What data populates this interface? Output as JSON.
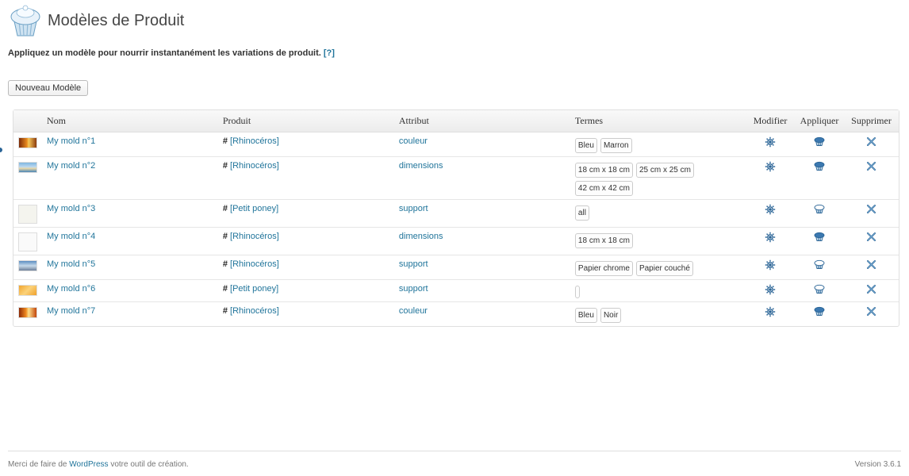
{
  "header": {
    "title": "Modèles de Produit",
    "logo_icon": "cupcake-icon"
  },
  "subtitle": {
    "text": "Appliquez un modèle pour nourrir instantanément les variations de produit.",
    "help_link": "[?]"
  },
  "toolbar": {
    "new_button": "Nouveau Modèle"
  },
  "table": {
    "columns": {
      "name": "Nom",
      "product": "Produit",
      "attribute": "Attribut",
      "terms": "Termes",
      "edit": "Modifier",
      "apply": "Appliquer",
      "delete": "Supprimer"
    },
    "product_prefix": "#",
    "rows": [
      {
        "name": "My mold n°1",
        "product": "[Rhinocéros]",
        "attribute": "couleur",
        "terms": [
          "Bleu",
          "Marron"
        ]
      },
      {
        "name": "My mold n°2",
        "product": "[Rhinocéros]",
        "attribute": "dimensions",
        "terms": [
          "18 cm x 18 cm",
          "25 cm x 25 cm",
          "42 cm x 42 cm"
        ]
      },
      {
        "name": "My mold n°3",
        "product": "[Petit poney]",
        "attribute": "support",
        "terms": [
          "all"
        ]
      },
      {
        "name": "My mold n°4",
        "product": "[Rhinocéros]",
        "attribute": "dimensions",
        "terms": [
          "18 cm x 18 cm"
        ]
      },
      {
        "name": "My mold n°5",
        "product": "[Rhinocéros]",
        "attribute": "support",
        "terms": [
          "Papier chrome",
          "Papier couché"
        ]
      },
      {
        "name": "My mold n°6",
        "product": "[Petit poney]",
        "attribute": "support",
        "terms": [
          ""
        ]
      },
      {
        "name": "My mold n°7",
        "product": "[Rhinocéros]",
        "attribute": "couleur",
        "terms": [
          "Bleu",
          "Noir"
        ]
      }
    ]
  },
  "footer": {
    "prefix": "Merci de faire de ",
    "link": "WordPress",
    "suffix": " votre outil de création.",
    "version": "Version 3.6.1"
  },
  "colors": {
    "link": "#21759b",
    "title": "#464646",
    "icon_blue": "#2a6496"
  }
}
